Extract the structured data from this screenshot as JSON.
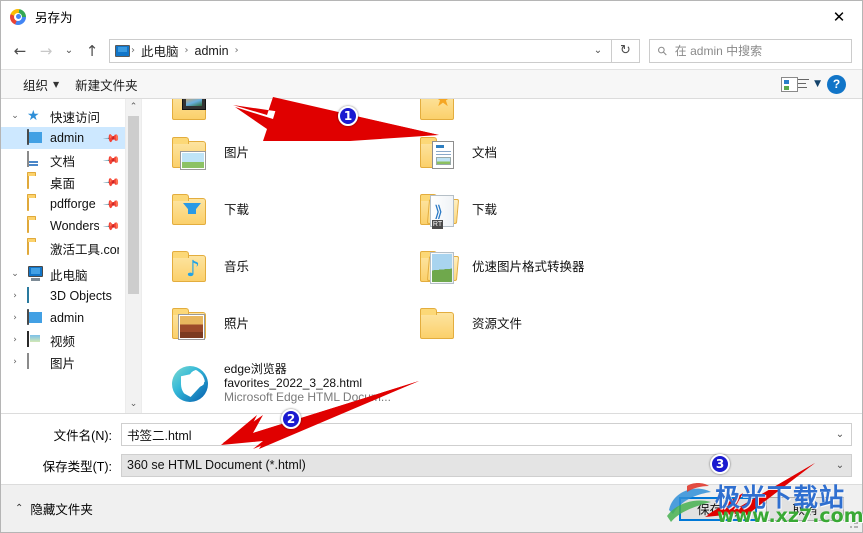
{
  "window": {
    "title": "另存为",
    "app_icon": "chrome-icon",
    "close_label": "✕"
  },
  "nav": {
    "back": "←",
    "forward": "→",
    "recent": "⌄",
    "up": "↑",
    "breadcrumbs": [
      "此电脑",
      "admin"
    ],
    "crumb_separator": "›",
    "dropdown": "⌄",
    "refresh": "↻",
    "search_placeholder": "在 admin 中搜索",
    "search_icon": "search-icon"
  },
  "commandbar": {
    "organize": "组织",
    "organize_caret": "▼",
    "new_folder": "新建文件夹",
    "view_icon": "view-style-icon",
    "view_caret": "▼",
    "help": "?"
  },
  "sidebar": {
    "groups": [
      {
        "label": "快速访问",
        "icon": "star-pin-icon",
        "expander": "⌄",
        "items": [
          {
            "label": "admin",
            "icon": "monitor-icon",
            "pinned": true,
            "selected": true
          },
          {
            "label": "文档",
            "icon": "documents-icon",
            "pinned": true,
            "selected": false
          },
          {
            "label": "桌面",
            "icon": "folder-icon",
            "pinned": true,
            "selected": false
          },
          {
            "label": "pdfforge",
            "icon": "folder-icon",
            "pinned": true,
            "selected": false
          },
          {
            "label": "Wondershar",
            "icon": "folder-icon",
            "pinned": true,
            "selected": false
          },
          {
            "label": "激活工具.com",
            "icon": "folder-icon",
            "pinned": false,
            "selected": false
          }
        ]
      },
      {
        "label": "此电脑",
        "icon": "this-pc-icon",
        "expander": "⌄",
        "items": [
          {
            "label": "3D Objects",
            "icon": "3d-objects-icon",
            "expander": "›"
          },
          {
            "label": "admin",
            "icon": "monitor-icon",
            "expander": "›"
          },
          {
            "label": "视频",
            "icon": "videos-icon",
            "expander": "›"
          },
          {
            "label": "图片",
            "icon": "pictures-icon",
            "expander": "›"
          }
        ]
      }
    ],
    "scroll_up": "⌃",
    "scroll_down": "⌄"
  },
  "filelist": {
    "partial_row": [
      {
        "label": "",
        "icon": "videos-folder-icon"
      },
      {
        "label": "",
        "icon": "favorites-folder-icon"
      }
    ],
    "rows": [
      [
        {
          "label": "图片",
          "icon": "pictures-folder-icon"
        },
        {
          "label": "文档",
          "icon": "documents-folder-icon"
        }
      ],
      [
        {
          "label": "下载",
          "icon": "downloads-folder-icon"
        },
        {
          "label": "下载",
          "icon": "downloads-rt-folder-icon"
        }
      ],
      [
        {
          "label": "音乐",
          "icon": "music-folder-icon"
        },
        {
          "label": "优速图片格式转换器",
          "icon": "picture-converter-folder-icon"
        }
      ],
      [
        {
          "label": "照片",
          "icon": "photos-folder-icon"
        },
        {
          "label": "资源文件",
          "icon": "resources-folder-icon"
        }
      ]
    ],
    "file_entry": {
      "icon": "edge-browser-icon",
      "line1": "edge浏览器",
      "line2": "favorites_2022_3_28.html",
      "line3": "Microsoft Edge HTML Docum..."
    }
  },
  "form": {
    "filename_label": "文件名(N):",
    "filename_value": "书签二.html",
    "filetype_label": "保存类型(T):",
    "filetype_value": "360 se HTML Document (*.html)",
    "chevron": "⌄"
  },
  "footer": {
    "hide_folders": "隐藏文件夹",
    "hide_chevron": "⌃",
    "save_button": "保存(S)",
    "cancel_button": "取消"
  },
  "annotations": {
    "step1": "1",
    "step2": "2",
    "step3": "3",
    "arrow_color": "#e00000"
  },
  "watermark": {
    "site_name": "极光下载站",
    "url": "www.xz7.com",
    "name_color": "#2f6fd0",
    "url_color": "#39a935"
  }
}
